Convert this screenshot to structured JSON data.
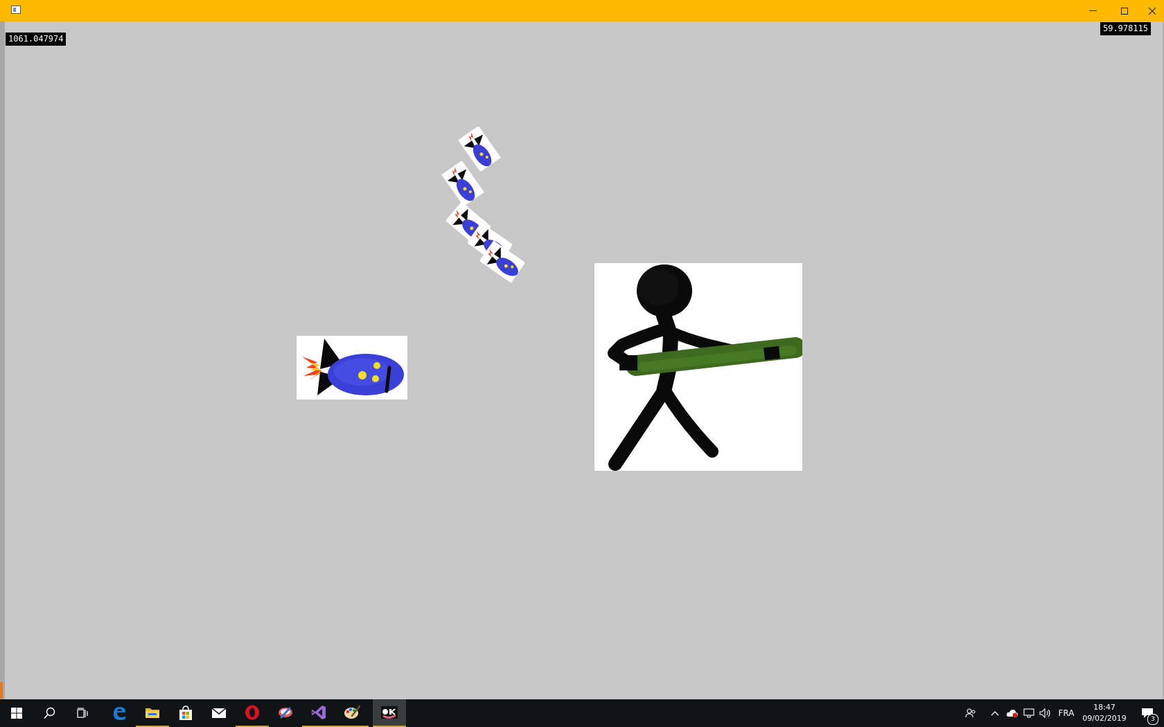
{
  "window": {
    "title_bar_color": "#ffb900",
    "buttons": [
      "minimize-icon",
      "maximize-icon",
      "close-icon"
    ]
  },
  "overlay": {
    "timer_value": "1061.047974",
    "fps_value": "59.978115"
  },
  "game": {
    "background_color": "#c8c8c8",
    "sprites": [
      "player-stickman-with-bazooka",
      "large-rocket",
      "small-rocket",
      "small-rocket",
      "small-rocket",
      "small-rocket",
      "small-rocket"
    ]
  },
  "taskbar": {
    "pinned_icons": [
      "windows-start-icon",
      "search-icon",
      "task-view-icon",
      "edge-icon",
      "file-explorer-icon",
      "store-icon",
      "mail-icon",
      "opera-icon",
      "paint-app-icon",
      "visual-studio-icon",
      "paint-palette-icon",
      "game-app-icon"
    ],
    "tray_icons": [
      "people-icon",
      "chevron-up-icon",
      "cloud-icon",
      "network-icon",
      "volume-icon"
    ],
    "language": "FRA",
    "time": "18:47",
    "date": "09/02/2019",
    "notification_count": "3"
  }
}
